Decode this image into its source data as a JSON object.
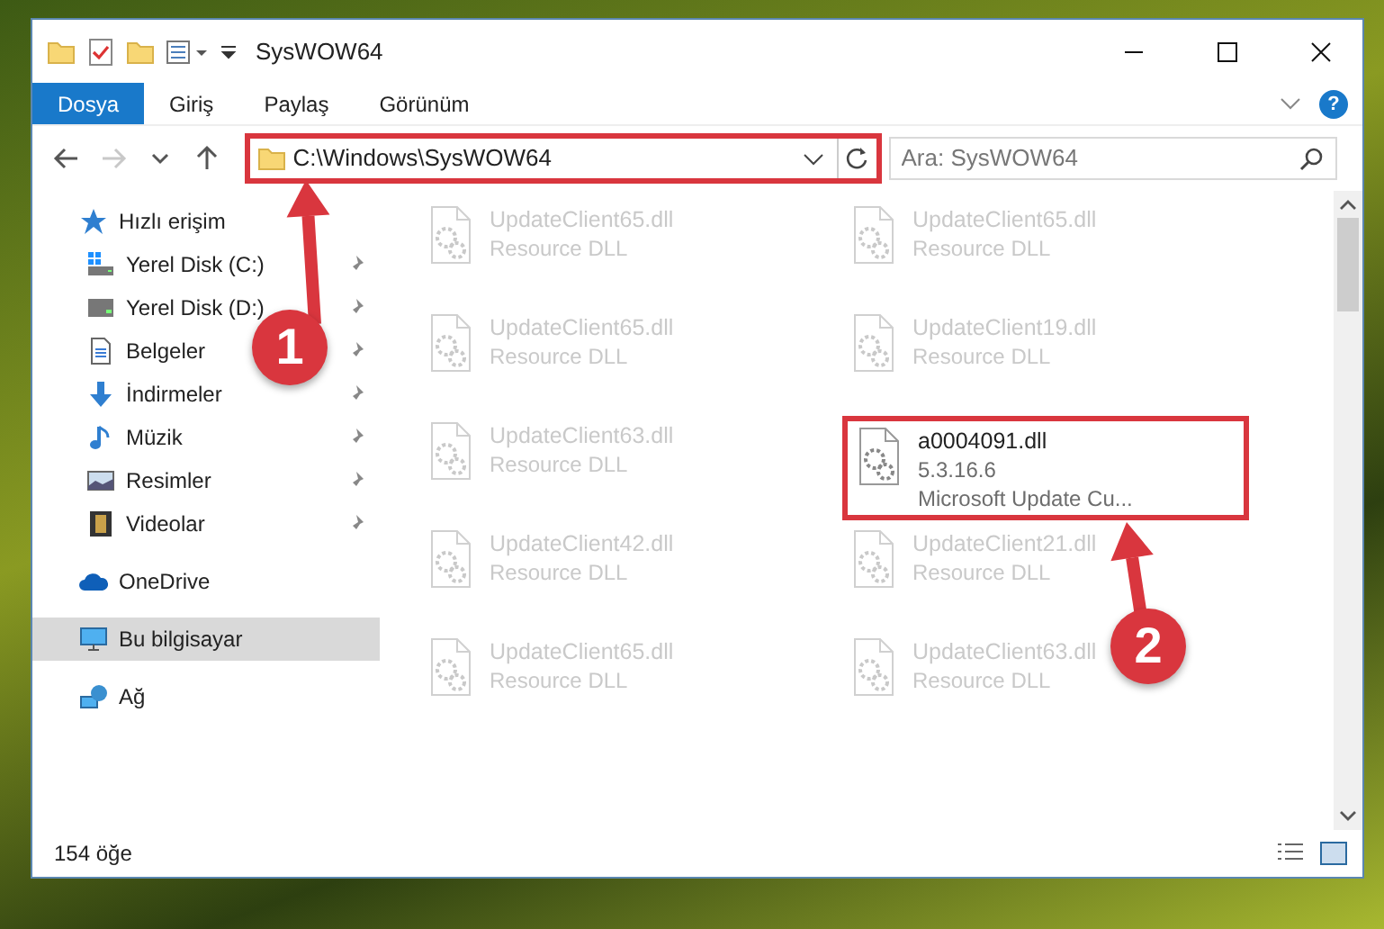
{
  "window": {
    "title": "SysWOW64"
  },
  "ribbon_tabs": [
    {
      "label": "Dosya",
      "selected": true
    },
    {
      "label": "Giriş",
      "selected": false
    },
    {
      "label": "Paylaş",
      "selected": false
    },
    {
      "label": "Görünüm",
      "selected": false
    }
  ],
  "help": "?",
  "navigation": {
    "back_disabled": false,
    "forward_disabled": true
  },
  "address_bar": {
    "path": "C:\\Windows\\SysWOW64",
    "highlighted": true
  },
  "search": {
    "placeholder": "Ara: SysWOW64"
  },
  "sidebar": {
    "items": [
      {
        "label": "Hızlı erişim",
        "kind": "star",
        "selected": false,
        "children": [
          {
            "label": "Yerel Disk (C:)",
            "kind": "system-drive",
            "pinned": true
          },
          {
            "label": "Yerel Disk (D:)",
            "kind": "drive",
            "pinned": true
          },
          {
            "label": "Belgeler",
            "kind": "documents",
            "pinned": true
          },
          {
            "label": "İndirmeler",
            "kind": "downloads",
            "pinned": true
          },
          {
            "label": "Müzik",
            "kind": "music",
            "pinned": true
          },
          {
            "label": "Resimler",
            "kind": "pictures",
            "pinned": true
          },
          {
            "label": "Videolar",
            "kind": "videos",
            "pinned": true
          }
        ]
      },
      {
        "label": "OneDrive",
        "kind": "cloud",
        "selected": false
      },
      {
        "label": "Bu bilgisayar",
        "kind": "computer",
        "selected": true
      },
      {
        "label": "Ağ",
        "kind": "network",
        "selected": false
      }
    ]
  },
  "files": [
    {
      "name": "UpdateClient65.dll",
      "details": [
        "Resource DLL"
      ],
      "blurred": true,
      "highlighted": false
    },
    {
      "name": "UpdateClient65.dll",
      "details": [
        "Resource DLL"
      ],
      "blurred": true,
      "highlighted": false
    },
    {
      "name": "UpdateClient65.dll",
      "details": [
        "Resource DLL"
      ],
      "blurred": true,
      "highlighted": false
    },
    {
      "name": "UpdateClient19.dll",
      "details": [
        "Resource DLL"
      ],
      "blurred": true,
      "highlighted": false
    },
    {
      "name": "UpdateClient63.dll",
      "details": [
        "Resource DLL"
      ],
      "blurred": true,
      "highlighted": false
    },
    {
      "name": "a0004091.dll",
      "details": [
        "5.3.16.6",
        "Microsoft Update Cu..."
      ],
      "blurred": false,
      "highlighted": true
    },
    {
      "name": "UpdateClient42.dll",
      "details": [
        "Resource DLL"
      ],
      "blurred": true,
      "highlighted": false
    },
    {
      "name": "UpdateClient21.dll",
      "details": [
        "Resource DLL"
      ],
      "blurred": true,
      "highlighted": false
    },
    {
      "name": "UpdateClient65.dll",
      "details": [
        "Resource DLL"
      ],
      "blurred": true,
      "highlighted": false
    },
    {
      "name": "UpdateClient63.dll",
      "details": [
        "Resource DLL"
      ],
      "blurred": true,
      "highlighted": false
    }
  ],
  "status_bar": {
    "item_count": "154 öğe"
  },
  "annotations": [
    {
      "number": "1"
    },
    {
      "number": "2"
    }
  ]
}
